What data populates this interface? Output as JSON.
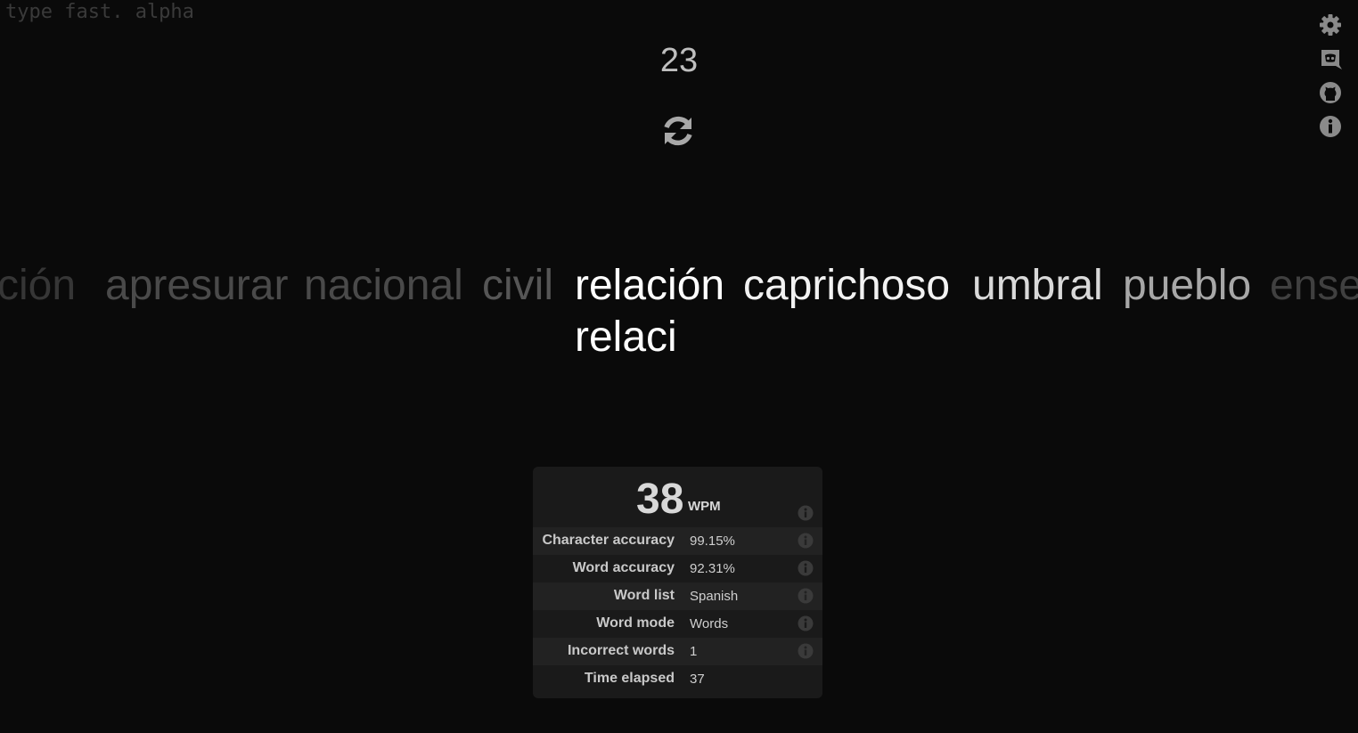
{
  "app": {
    "logo_text": "type fast. alpha"
  },
  "counter": {
    "value": "23"
  },
  "words": {
    "line": [
      "ción",
      "apresurar",
      "nacional",
      "civil",
      "relación",
      "caprichoso",
      "umbral",
      "pueblo",
      "ense"
    ],
    "typed": "relaci"
  },
  "results": {
    "wpm_value": "38",
    "wpm_unit": "WPM",
    "rows": [
      {
        "label": "Character accuracy",
        "value": "99.15%"
      },
      {
        "label": "Word accuracy",
        "value": "92.31%"
      },
      {
        "label": "Word list",
        "value": "Spanish"
      },
      {
        "label": "Word mode",
        "value": "Words"
      },
      {
        "label": "Incorrect words",
        "value": "1"
      },
      {
        "label": "Time elapsed",
        "value": "37"
      }
    ]
  },
  "icons": {
    "reset": "refresh-icon",
    "settings": "gear-icon",
    "discord": "discord-icon",
    "github": "github-icon",
    "info": "info-icon"
  },
  "colors": {
    "background": "#0a0a0a",
    "panel": "#1a1a1a",
    "text_active": "#ffffff",
    "text_dim": "#404040"
  }
}
